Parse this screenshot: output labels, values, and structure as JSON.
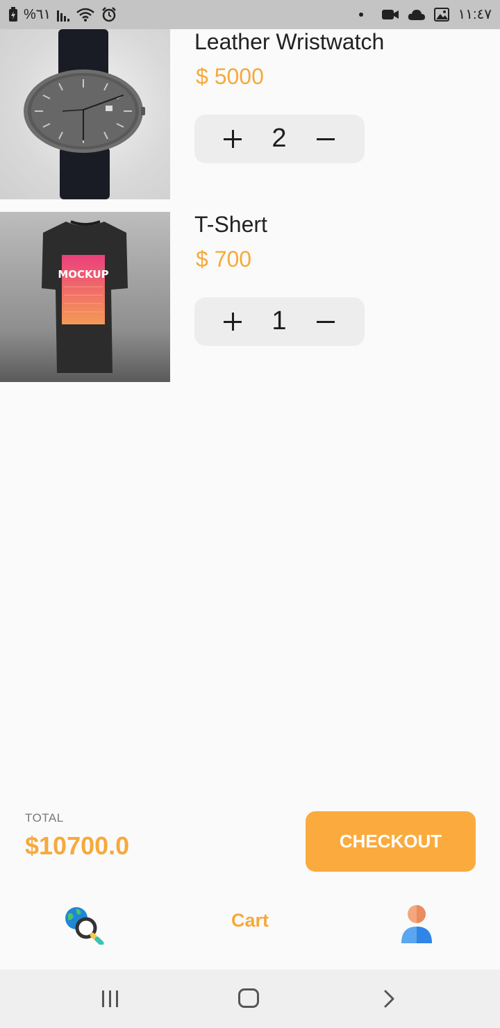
{
  "status_bar": {
    "battery_percent": "%٦١",
    "time": "١١:٤٧",
    "icons": [
      "battery-charging-icon",
      "signal-icon",
      "wifi-icon",
      "alarm-icon",
      "notification-dot-icon",
      "video-icon",
      "cloud-icon",
      "image-icon"
    ]
  },
  "items": [
    {
      "name": "Leather Wristwatch",
      "price": "$ 5000",
      "quantity": "2",
      "image": "watch-image"
    },
    {
      "name": "T-Shert",
      "price": "$ 700",
      "quantity": "1",
      "image": "tshirt-image",
      "image_text": "MOCKUP"
    }
  ],
  "summary": {
    "total_label": "TOTAL",
    "total_value": "$10700.0",
    "checkout_label": "CHECKOUT"
  },
  "bottom_nav": {
    "items": [
      {
        "icon": "globe-search-icon"
      },
      {
        "label": "Cart"
      },
      {
        "icon": "user-icon"
      }
    ]
  },
  "system_nav": {
    "icons": [
      "recent-apps-icon",
      "home-icon",
      "back-icon"
    ]
  },
  "colors": {
    "accent": "#f6a93b",
    "checkout_bg": "#fbab3e",
    "stepper_bg": "#ededed"
  }
}
